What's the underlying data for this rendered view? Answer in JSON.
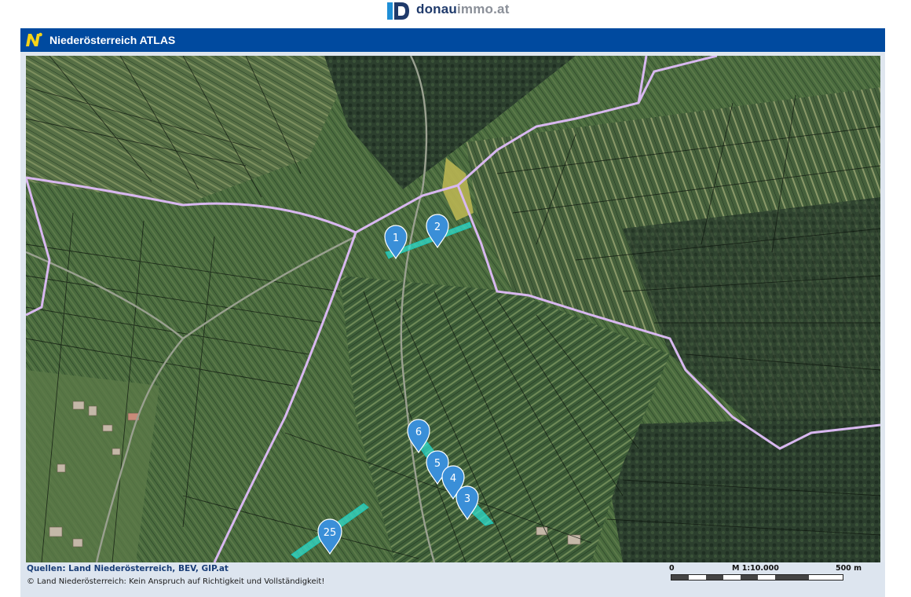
{
  "site": {
    "logo_alt": "donauimmo.at",
    "brand_bold": "donau",
    "brand_light": "immo.at"
  },
  "atlas": {
    "title": "Niederösterreich ATLAS",
    "header_color": "#004a9f"
  },
  "map": {
    "markers": [
      {
        "label": "1"
      },
      {
        "label": "2"
      },
      {
        "label": "3"
      },
      {
        "label": "4"
      },
      {
        "label": "5"
      },
      {
        "label": "6"
      },
      {
        "label": "25"
      }
    ],
    "marker_color": "#3a8fd8",
    "parcel_highlight_color": "#2ee6d6",
    "boundary_color": "#d8b8f0"
  },
  "footer": {
    "sources": "Quellen: Land Niederösterreich, BEV, GIP.at",
    "copyright": "© Land Niederösterreich: Kein Anspruch auf Richtigkeit und Vollständigkeit!",
    "scale_start": "0",
    "scale_ratio": "M 1:10.000",
    "scale_end": "500 m"
  }
}
